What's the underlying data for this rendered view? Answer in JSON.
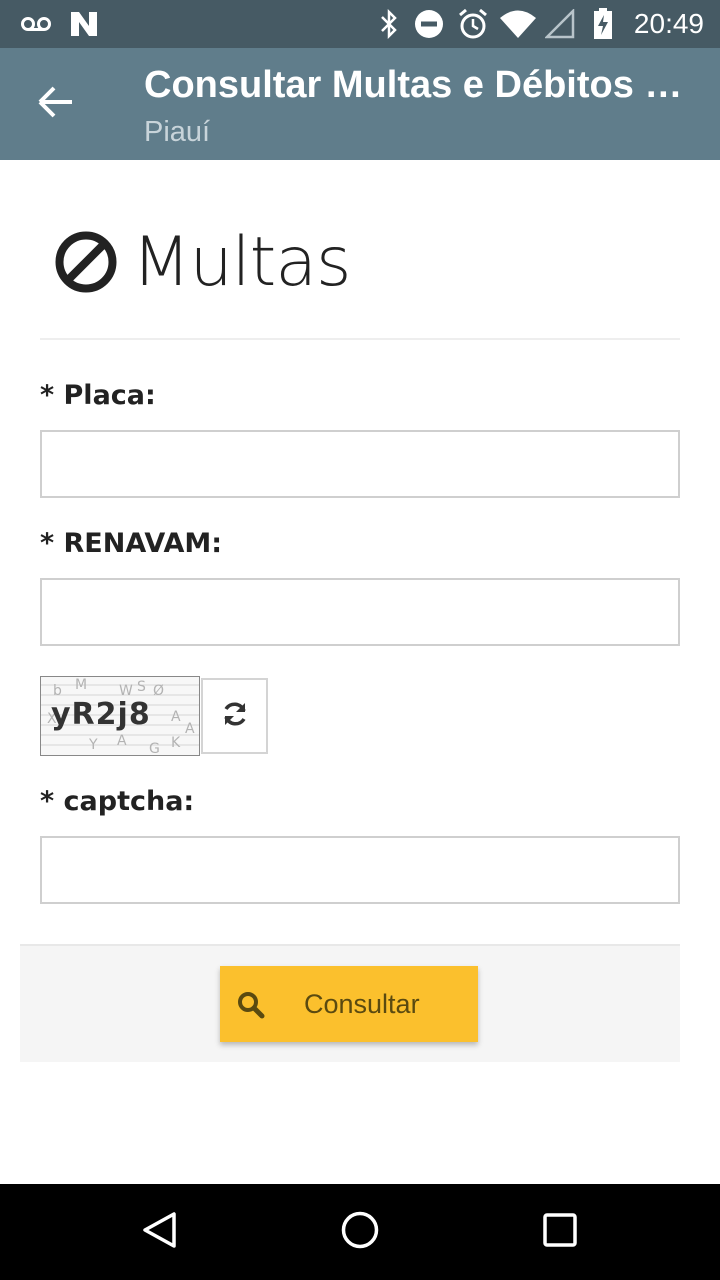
{
  "status_bar": {
    "time": "20:49",
    "icons": [
      "voicemail-icon",
      "n-logo-icon",
      "bluetooth-icon",
      "do-not-disturb-icon",
      "alarm-icon",
      "wifi-icon",
      "signal-icon",
      "battery-charging-icon"
    ]
  },
  "app_bar": {
    "title": "Consultar Multas e Débitos - Piauí",
    "subtitle": "Piauí",
    "back_icon": "arrow-back-icon"
  },
  "heading": {
    "icon": "prohibited-icon",
    "text": "Multas"
  },
  "form": {
    "placa_label": "* Placa:",
    "placa_value": "",
    "renavam_label": "* RENAVAM:",
    "renavam_value": "",
    "captcha_image_text": "yR2j8",
    "refresh_icon": "refresh-icon",
    "captcha_label": "* captcha:",
    "captcha_value": "",
    "submit_label": "Consultar",
    "submit_icon": "search-icon"
  },
  "colors": {
    "status_bar": "#465a64",
    "app_bar": "#607d8b",
    "accent": "#fbc02d"
  },
  "nav_bar": {
    "buttons": [
      "back-triangle-icon",
      "home-circle-icon",
      "recents-square-icon"
    ]
  }
}
